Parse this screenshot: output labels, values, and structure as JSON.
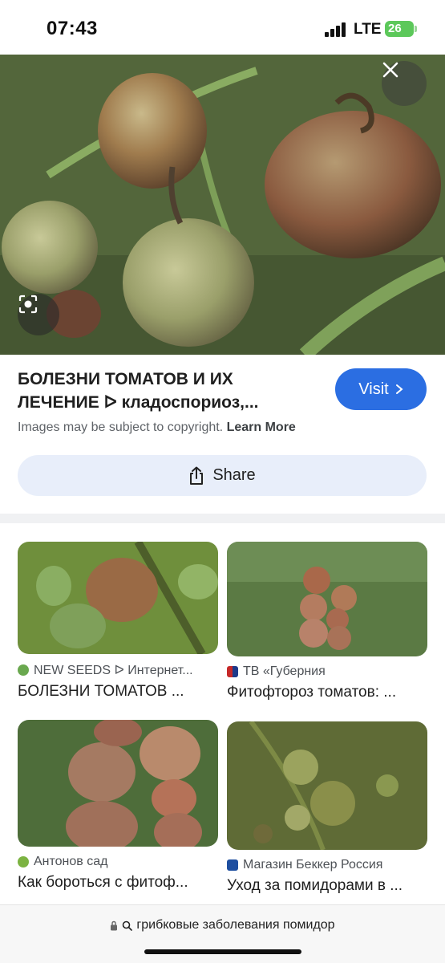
{
  "status": {
    "time": "07:43",
    "network": "LTE",
    "battery": "26"
  },
  "result": {
    "title": "БОЛЕЗНИ ТОМАТОВ И ИХ\nЛЕЧЕНИЕ ᐅ кладоспориоз,...",
    "visit_label": "Visit",
    "copyright_text": "Images may be subject to copyright.",
    "learn_more": "Learn More",
    "share_label": "Share"
  },
  "related": [
    {
      "source": "NEW SEEDS ᐅ Интернет...",
      "title": "БОЛЕЗНИ ТОМАТОВ ...",
      "icon_color": "#6aa84f"
    },
    {
      "source": "ТВ «Губерния",
      "title": "Фитофтороз томатов: ...",
      "icon_color": "#c62828"
    },
    {
      "source": "Антонов сад",
      "title": "Как бороться с фитоф...",
      "icon_color": "#7cb342"
    },
    {
      "source": "Магазин Беккер Россия",
      "title": "Уход за помидорами в ...",
      "icon_color": "#1e4fa0"
    }
  ],
  "browser": {
    "url": "грибковые заболевания помидор"
  },
  "icons": [
    "close-icon",
    "lens-icon",
    "chevron-right-icon",
    "share-icon",
    "lock-icon",
    "search-icon"
  ]
}
